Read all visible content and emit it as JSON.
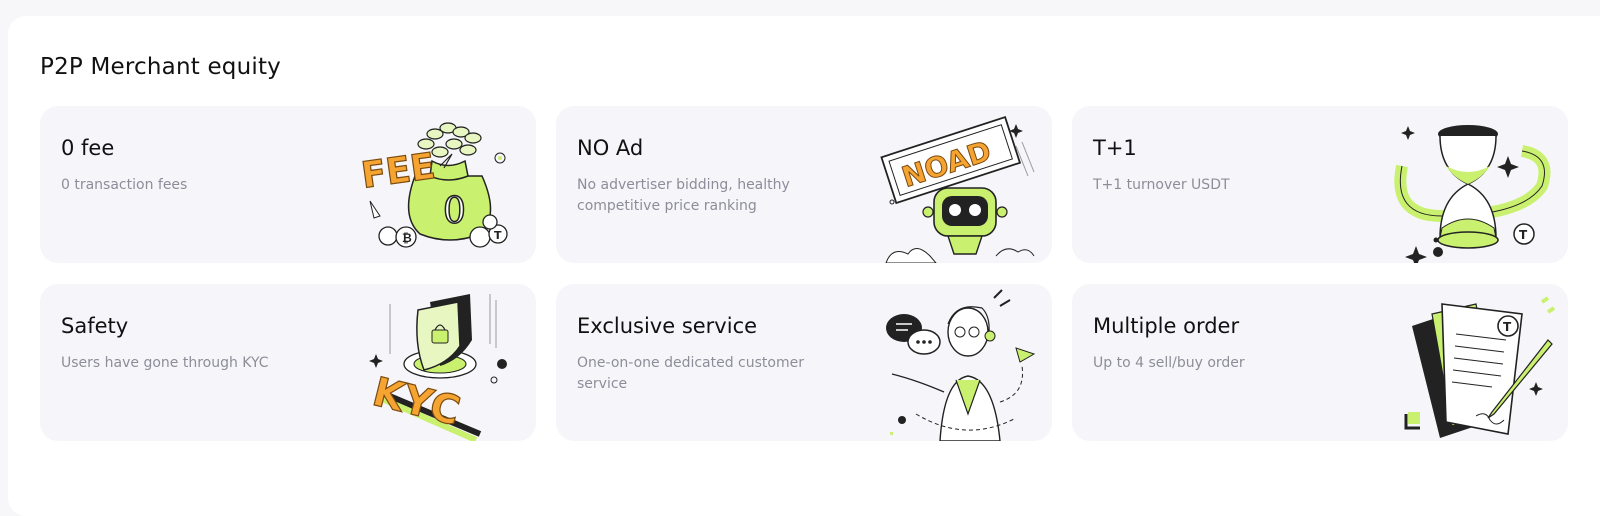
{
  "section": {
    "title": "P2P Merchant equity"
  },
  "cards": [
    {
      "title": "0 fee",
      "desc": "0 transaction fees",
      "icon": "money-bag-fee-icon"
    },
    {
      "title": "NO Ad",
      "desc": "No advertiser bidding, healthy competitive price ranking",
      "icon": "robot-noad-sign-icon"
    },
    {
      "title": "T+1",
      "desc": "T+1 turnover USDT",
      "icon": "hourglass-icon"
    },
    {
      "title": "Safety",
      "desc": "Users have gone through KYC",
      "icon": "shield-kyc-icon"
    },
    {
      "title": "Exclusive service",
      "desc": "One-on-one dedicated customer service",
      "icon": "customer-service-agent-icon"
    },
    {
      "title": "Multiple order",
      "desc": "Up to 4 sell/buy order",
      "icon": "documents-pen-icon"
    }
  ],
  "illustration_text": {
    "fee_word": "FEE",
    "zero": "0",
    "noad_word": "NOAD",
    "kyc_word": "KYC"
  },
  "colors": {
    "accent_green": "#c9f06e",
    "accent_orange": "#f5a431",
    "text_primary": "#111111",
    "text_secondary": "#8d8d99",
    "card_bg": "#f6f6fa"
  }
}
